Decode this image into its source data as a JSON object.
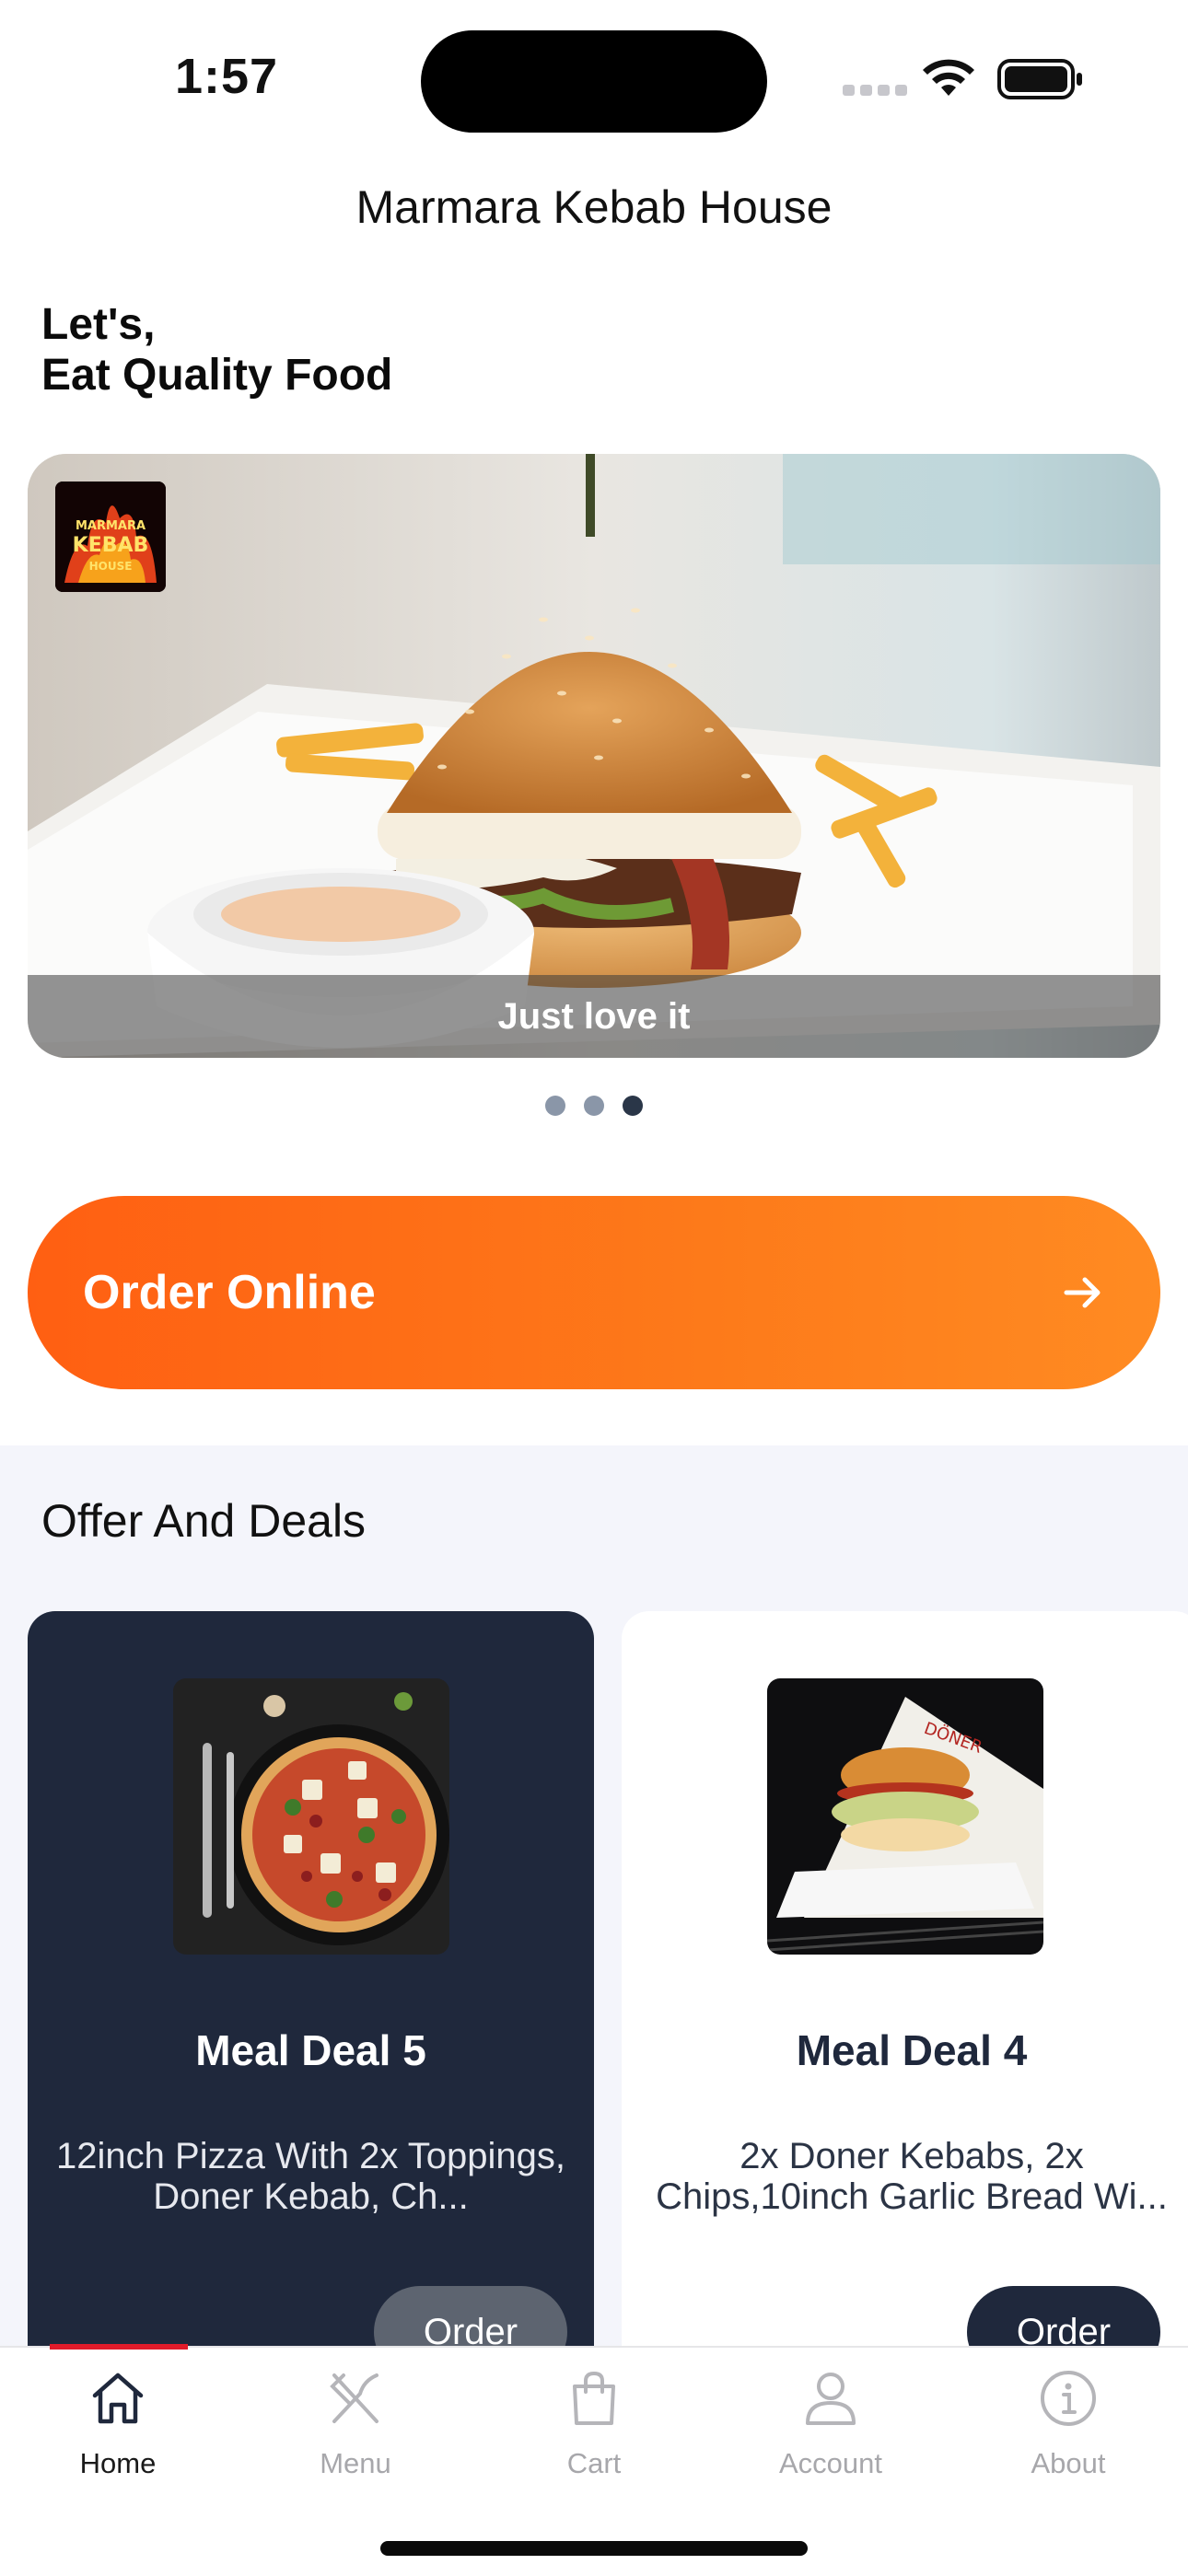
{
  "status_bar": {
    "time": "1:57"
  },
  "header": {
    "title": "Marmara Kebab House"
  },
  "greeting": {
    "line1": "Let's,",
    "line2": "Eat Quality Food"
  },
  "hero": {
    "caption": "Just love it",
    "logo_text_1": "MARMARA",
    "logo_text_2": "KEBAB",
    "logo_text_3": "HOUSE",
    "slide_count": 3,
    "active_slide": 3
  },
  "order_online": {
    "label": "Order Online"
  },
  "offers": {
    "title": "Offer And Deals",
    "cards": [
      {
        "title": "Meal Deal 5",
        "description": "12inch Pizza With 2x Toppings, Doner Kebab, Ch...",
        "button": "Order"
      },
      {
        "title": "Meal Deal 4",
        "description": "2x Doner Kebabs, 2x Chips,10inch Garlic Bread Wi...",
        "button": "Order"
      }
    ]
  },
  "tabbar": {
    "items": [
      {
        "label": "Home",
        "icon": "home-icon",
        "active": true
      },
      {
        "label": "Menu",
        "icon": "fork-knife-icon",
        "active": false
      },
      {
        "label": "Cart",
        "icon": "shopping-bag-icon",
        "active": false
      },
      {
        "label": "Account",
        "icon": "user-icon",
        "active": false
      },
      {
        "label": "About",
        "icon": "info-icon",
        "active": false
      }
    ]
  },
  "colors": {
    "brand_orange": "#ff6a14",
    "navy": "#1f283c",
    "tab_active_indicator": "#e11b2a",
    "section_bg": "#f4f5fb"
  }
}
